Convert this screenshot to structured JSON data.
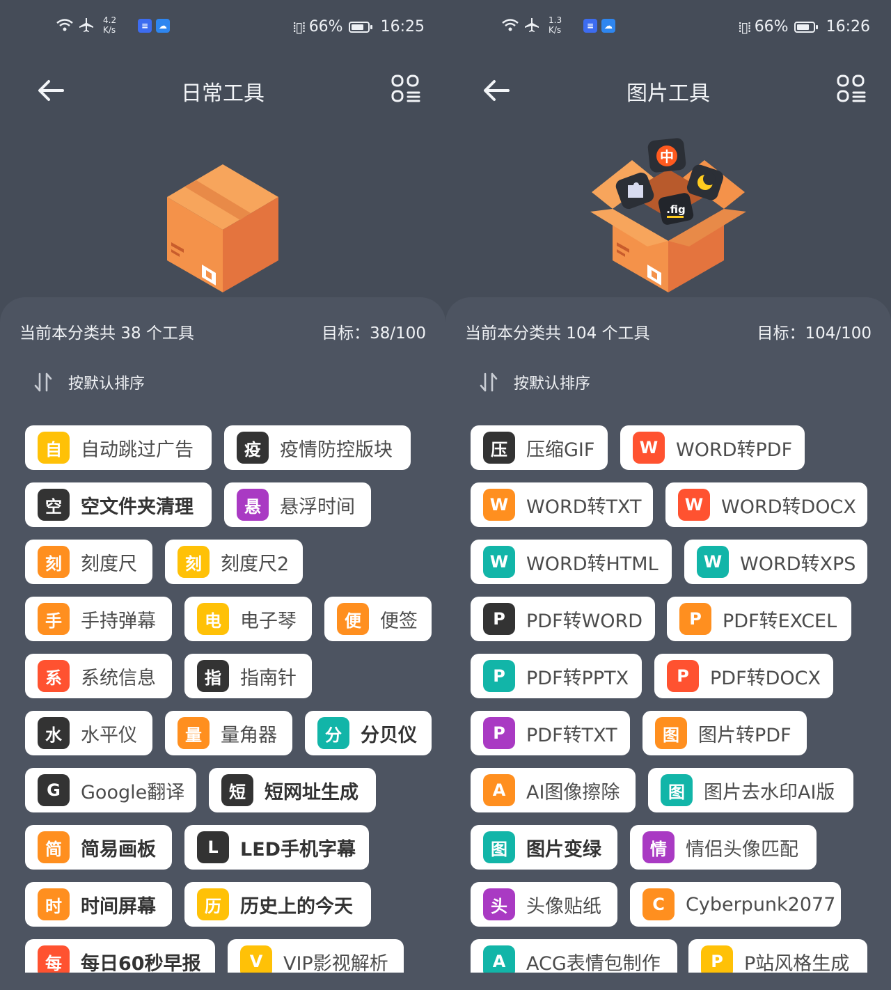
{
  "colors": {
    "background": "#454c58",
    "panel": "#4d5461",
    "chip": "#ffffff",
    "yellow": "#ffc107",
    "orange": "#ff8f1f",
    "red": "#ff5230",
    "purple": "#a93ac3",
    "teal": "#12b5a8",
    "dark": "#333333"
  },
  "left": {
    "status": {
      "net_speed_value": "4.2",
      "net_speed_unit": "K/s",
      "battery_percent": "66%",
      "time": "16:25",
      "battery_level": 0.66
    },
    "title": "日常工具",
    "count_text": "当前本分类共 38 个工具",
    "goal_text": "目标：38/100",
    "sort_label": "按默认排序",
    "tools": [
      {
        "glyph": "自",
        "label": "自动跳过广告",
        "color": "yellow",
        "bold": false
      },
      {
        "glyph": "疫",
        "label": "疫情防控版块",
        "color": "dark",
        "bold": false
      },
      {
        "glyph": "空",
        "label": "空文件夹清理",
        "color": "dark",
        "bold": true
      },
      {
        "glyph": "悬",
        "label": "悬浮时间",
        "color": "purple",
        "bold": false
      },
      {
        "glyph": "刻",
        "label": "刻度尺",
        "color": "orange",
        "bold": false
      },
      {
        "glyph": "刻",
        "label": "刻度尺2",
        "color": "yellow",
        "bold": false
      },
      {
        "glyph": "手",
        "label": "手持弹幕",
        "color": "orange",
        "bold": false
      },
      {
        "glyph": "电",
        "label": "电子琴",
        "color": "yellow",
        "bold": false
      },
      {
        "glyph": "便",
        "label": "便签",
        "color": "orange",
        "bold": false
      },
      {
        "glyph": "系",
        "label": "系统信息",
        "color": "red",
        "bold": false
      },
      {
        "glyph": "指",
        "label": "指南针",
        "color": "dark",
        "bold": false
      },
      {
        "glyph": "水",
        "label": "水平仪",
        "color": "dark",
        "bold": false
      },
      {
        "glyph": "量",
        "label": "量角器",
        "color": "orange",
        "bold": false
      },
      {
        "glyph": "分",
        "label": "分贝仪",
        "color": "teal",
        "bold": true
      },
      {
        "glyph": "G",
        "label": "Google翻译",
        "color": "dark",
        "bold": false
      },
      {
        "glyph": "短",
        "label": "短网址生成",
        "color": "dark",
        "bold": true
      },
      {
        "glyph": "简",
        "label": "简易画板",
        "color": "orange",
        "bold": true
      },
      {
        "glyph": "L",
        "label": "LED手机字幕",
        "color": "dark",
        "bold": true
      },
      {
        "glyph": "时",
        "label": "时间屏幕",
        "color": "orange",
        "bold": true
      },
      {
        "glyph": "历",
        "label": "历史上的今天",
        "color": "yellow",
        "bold": true
      },
      {
        "glyph": "每",
        "label": "每日60秒早报",
        "color": "red",
        "bold": true
      },
      {
        "glyph": "V",
        "label": "VIP影视解析",
        "color": "yellow",
        "bold": false
      }
    ]
  },
  "right": {
    "status": {
      "net_speed_value": "1.3",
      "net_speed_unit": "K/s",
      "battery_percent": "66%",
      "time": "16:26",
      "battery_level": 0.66
    },
    "title": "图片工具",
    "count_text": "当前本分类共 104 个工具",
    "goal_text": "目标：104/100",
    "sort_label": "按默认排序",
    "hero_box_labels": {
      "zh": "中",
      "fig": ".fig"
    },
    "tools": [
      {
        "glyph": "压",
        "label": "压缩GIF",
        "color": "dark",
        "bold": false
      },
      {
        "glyph": "W",
        "label": "WORD转PDF",
        "color": "red",
        "bold": false
      },
      {
        "glyph": "W",
        "label": "WORD转TXT",
        "color": "orange",
        "bold": false
      },
      {
        "glyph": "W",
        "label": "WORD转DOCX",
        "color": "red",
        "bold": false
      },
      {
        "glyph": "W",
        "label": "WORD转HTML",
        "color": "teal",
        "bold": false
      },
      {
        "glyph": "W",
        "label": "WORD转XPS",
        "color": "teal",
        "bold": false
      },
      {
        "glyph": "P",
        "label": "PDF转WORD",
        "color": "dark",
        "bold": false
      },
      {
        "glyph": "P",
        "label": "PDF转EXCEL",
        "color": "orange",
        "bold": false
      },
      {
        "glyph": "P",
        "label": "PDF转PPTX",
        "color": "teal",
        "bold": false
      },
      {
        "glyph": "P",
        "label": "PDF转DOCX",
        "color": "red",
        "bold": false
      },
      {
        "glyph": "P",
        "label": "PDF转TXT",
        "color": "purple",
        "bold": false
      },
      {
        "glyph": "图",
        "label": "图片转PDF",
        "color": "orange",
        "bold": false
      },
      {
        "glyph": "A",
        "label": "AI图像擦除",
        "color": "orange",
        "bold": false
      },
      {
        "glyph": "图",
        "label": "图片去水印AI版",
        "color": "teal",
        "bold": false
      },
      {
        "glyph": "图",
        "label": "图片变绿",
        "color": "teal",
        "bold": true
      },
      {
        "glyph": "情",
        "label": "情侣头像匹配",
        "color": "purple",
        "bold": false
      },
      {
        "glyph": "头",
        "label": "头像贴纸",
        "color": "purple",
        "bold": false
      },
      {
        "glyph": "C",
        "label": "Cyberpunk2077",
        "color": "orange",
        "bold": false
      },
      {
        "glyph": "A",
        "label": "ACG表情包制作",
        "color": "teal",
        "bold": false
      },
      {
        "glyph": "P",
        "label": "P站风格生成",
        "color": "yellow",
        "bold": false
      }
    ]
  }
}
